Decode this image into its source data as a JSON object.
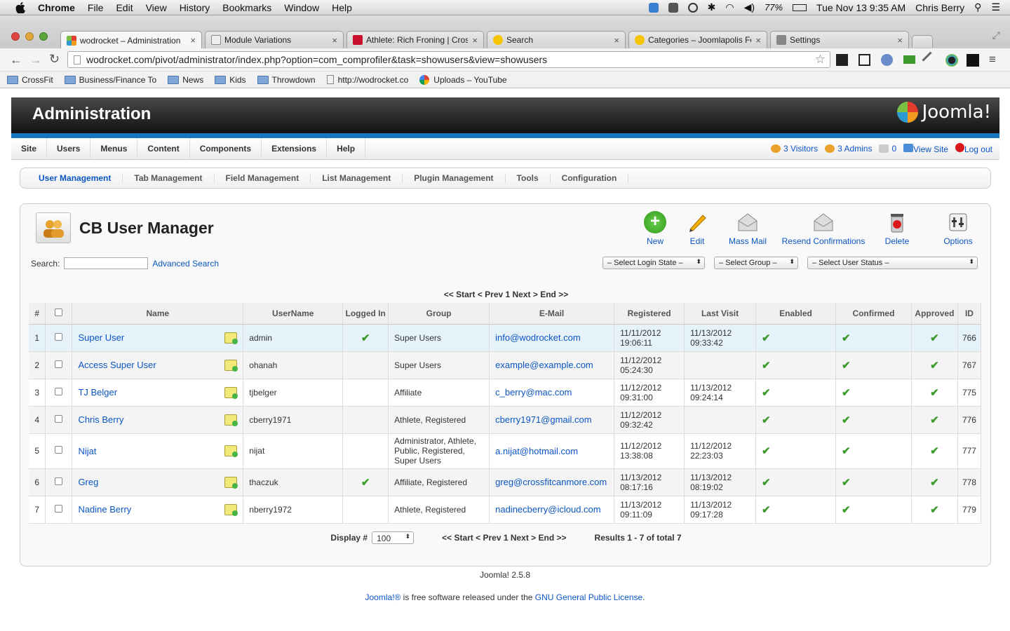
{
  "menubar": {
    "app": "Chrome",
    "items": [
      "File",
      "Edit",
      "View",
      "History",
      "Bookmarks",
      "Window",
      "Help"
    ],
    "battery": "77%",
    "clock": "Tue Nov 13  9:35 AM",
    "user": "Chris Berry"
  },
  "tabs": [
    {
      "title": "wodrocket – Administration",
      "active": true
    },
    {
      "title": "Module Variations",
      "active": false
    },
    {
      "title": "Athlete: Rich Froning | Cross",
      "active": false
    },
    {
      "title": "Search",
      "active": false
    },
    {
      "title": "Categories – Joomlapolis For",
      "active": false
    },
    {
      "title": "Settings",
      "active": false
    }
  ],
  "omnibox": {
    "url": "wodrocket.com/pivot/administrator/index.php?option=com_comprofiler&task=showusers&view=showusers"
  },
  "bookmarks": [
    "CrossFit",
    "Business/Finance To",
    "News",
    "Kids",
    "Throwdown",
    "http://wodrocket.co",
    "Uploads – YouTube"
  ],
  "admin": {
    "title": "Administration",
    "logo": "Joomla!"
  },
  "nav": [
    "Site",
    "Users",
    "Menus",
    "Content",
    "Components",
    "Extensions",
    "Help"
  ],
  "status": {
    "visitors": "3 Visitors",
    "admins": "3 Admins",
    "messages": "0",
    "view_site": "View Site",
    "logout": "Log out"
  },
  "subnav": [
    "User Management",
    "Tab Management",
    "Field Management",
    "List Management",
    "Plugin Management",
    "Tools",
    "Configuration"
  ],
  "panel": {
    "title": "CB User Manager",
    "toolbar": [
      "New",
      "Edit",
      "Mass Mail",
      "Resend Confirmations",
      "Delete",
      "Options"
    ],
    "search_label": "Search:",
    "advanced_search": "Advanced Search",
    "filters": [
      "– Select Login State –",
      "– Select Group –",
      "– Select User Status –"
    ],
    "pager": "<< Start < Prev 1 Next > End >>"
  },
  "table": {
    "headers": [
      "#",
      "",
      "Name",
      "UserName",
      "Logged In",
      "Group",
      "E-Mail",
      "Registered",
      "Last Visit",
      "Enabled",
      "Confirmed",
      "Approved",
      "ID"
    ],
    "rows": [
      {
        "n": "1",
        "name": "Super User",
        "username": "admin",
        "loggedin": true,
        "group": "Super Users",
        "email": "info@wodrocket.com",
        "reg1": "11/11/2012",
        "reg2": "19:06:11",
        "lv1": "11/13/2012",
        "lv2": "09:33:42",
        "id": "766"
      },
      {
        "n": "2",
        "name": "Access Super User",
        "username": "ohanah",
        "loggedin": false,
        "group": "Super Users",
        "email": "example@example.com",
        "reg1": "11/12/2012",
        "reg2": "05:24:30",
        "lv1": "",
        "lv2": "",
        "id": "767"
      },
      {
        "n": "3",
        "name": "TJ Belger",
        "username": "tjbelger",
        "loggedin": false,
        "group": "Affiliate",
        "email": "c_berry@mac.com",
        "reg1": "11/12/2012",
        "reg2": "09:31:00",
        "lv1": "11/13/2012",
        "lv2": "09:24:14",
        "id": "775"
      },
      {
        "n": "4",
        "name": "Chris Berry",
        "username": "cberry1971",
        "loggedin": false,
        "group": "Athlete, Registered",
        "email": "cberry1971@gmail.com",
        "reg1": "11/12/2012",
        "reg2": "09:32:42",
        "lv1": "",
        "lv2": "",
        "id": "776"
      },
      {
        "n": "5",
        "name": "Nijat",
        "username": "nijat",
        "loggedin": false,
        "group": "Administrator, Athlete, Public, Registered, Super Users",
        "email": "a.nijat@hotmail.com",
        "reg1": "11/12/2012",
        "reg2": "13:38:08",
        "lv1": "11/12/2012",
        "lv2": "22:23:03",
        "id": "777"
      },
      {
        "n": "6",
        "name": "Greg",
        "username": "thaczuk",
        "loggedin": true,
        "group": "Affiliate, Registered",
        "email": "greg@crossfitcanmore.com",
        "reg1": "11/13/2012",
        "reg2": "08:17:16",
        "lv1": "11/13/2012",
        "lv2": "08:19:02",
        "id": "778"
      },
      {
        "n": "7",
        "name": "Nadine Berry",
        "username": "nberry1972",
        "loggedin": false,
        "group": "Athlete, Registered",
        "email": "nadinecberry@icloud.com",
        "reg1": "11/13/2012",
        "reg2": "09:11:09",
        "lv1": "11/13/2012",
        "lv2": "09:17:28",
        "id": "779"
      }
    ]
  },
  "footer": {
    "display_label": "Display #",
    "display_value": "100",
    "pager": "<< Start < Prev 1 Next > End >>",
    "results": "Results 1 - 7 of total 7",
    "version": "Joomla! 2.5.8",
    "license_link1": "Joomla!®",
    "license_text": " is free software released under the ",
    "license_link2": "GNU General Public License",
    "license_end": "."
  }
}
